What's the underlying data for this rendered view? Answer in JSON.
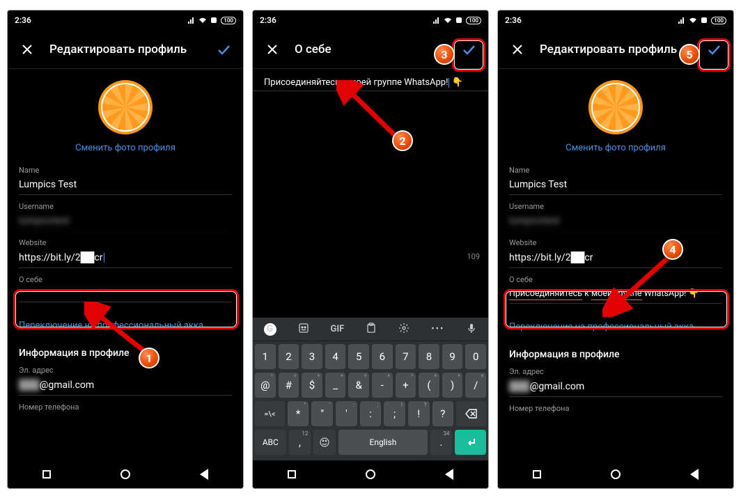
{
  "status": {
    "time": "2:36",
    "battery": "100"
  },
  "screen1": {
    "title": "Редактировать профиль",
    "changePhoto": "Сменить фото профиля",
    "nameLabel": "Name",
    "nameValue": "Lumpics Test",
    "usernameLabel": "Username",
    "usernameValue": "lumpicstest",
    "websiteLabel": "Website",
    "websiteValue": "https://bit.ly/2██cr",
    "bioLabel": "О себе",
    "bioValue": "",
    "switchPro": "Переключение на профессиональный акка...",
    "infoTitle": "Информация в профиле",
    "emailLabel": "Эл. адрес",
    "emailValue": "████@gmail.com",
    "phoneLabel": "Номер телефона"
  },
  "screen2": {
    "title": "О себе",
    "bioText": "Присоединяйтесь к моей группе WhatsApp!",
    "bioEmoji": "👇",
    "charCount": "109",
    "kbdTop": [
      "GIF"
    ],
    "row1": [
      [
        "1",
        ""
      ],
      [
        "2",
        ""
      ],
      [
        "3",
        ""
      ],
      [
        "4",
        ""
      ],
      [
        "5",
        ""
      ],
      [
        "6",
        ""
      ],
      [
        "7",
        ""
      ],
      [
        "8",
        ""
      ],
      [
        "9",
        ""
      ],
      [
        "0",
        ""
      ]
    ],
    "row2": [
      [
        "@",
        "¹"
      ],
      [
        "#",
        "²"
      ],
      [
        "$",
        "³"
      ],
      [
        "_",
        "⁴"
      ],
      [
        "&",
        "⁵"
      ],
      [
        "-",
        "⁶"
      ],
      [
        "+",
        "⁷"
      ],
      [
        "(",
        "⁸"
      ],
      [
        ")",
        "⁹"
      ],
      [
        "/",
        "⁰"
      ]
    ],
    "row3": [
      [
        "*",
        "\""
      ],
      [
        "\"",
        "'"
      ],
      [
        "'",
        ":"
      ],
      [
        ":",
        ";"
      ],
      [
        ";",
        "!"
      ],
      [
        "!",
        "?"
      ],
      [
        "?",
        ""
      ]
    ],
    "row4Lang": "English",
    "shiftLabel": "=\\<",
    "abcLabel": "ABC",
    "commaSub": "12",
    "dotSub": "34"
  },
  "screen3": {
    "title": "Редактировать профиль",
    "changePhoto": "Сменить фото профиля",
    "nameLabel": "Name",
    "nameValue": "Lumpics Test",
    "usernameLabel": "Username",
    "usernameValue": "lumpicstest",
    "websiteLabel": "Website",
    "websiteValue": "https://bit.ly/2██cr",
    "bioLabel": "О себе",
    "bioValue": "Присоединяйтесь к моей группе WhatsApp! 👇",
    "switchPro": "Переключение на профессиональный акка...",
    "infoTitle": "Информация в профиле",
    "emailLabel": "Эл. адрес",
    "emailValue": "████@gmail.com",
    "phoneLabel": "Номер телефона"
  },
  "markers": {
    "m1": "1",
    "m2": "2",
    "m3": "3",
    "m4": "4",
    "m5": "5"
  }
}
